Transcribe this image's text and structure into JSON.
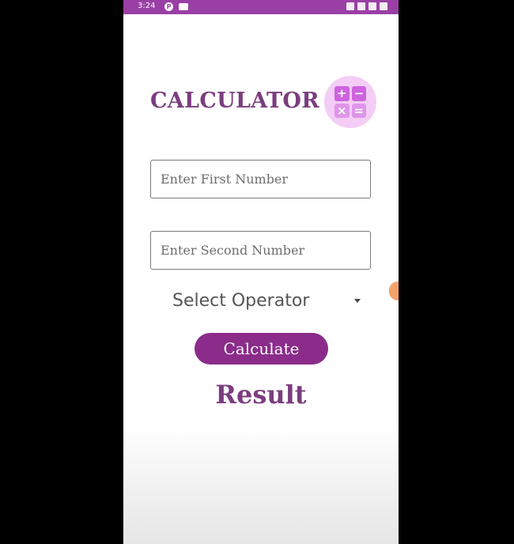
{
  "status_bar": {
    "time": "3:24",
    "app_badge_letter": "P",
    "background_color": "#9a3fa6"
  },
  "app": {
    "title": "CALCULATOR",
    "logo_icon": "calculator-icon",
    "logo_symbols": [
      "+",
      "−",
      "×",
      "="
    ],
    "accent_color": "#8b2c8a",
    "title_color": "#7b3d7f"
  },
  "form": {
    "first_number": {
      "value": "",
      "placeholder": "Enter First Number"
    },
    "second_number": {
      "value": "",
      "placeholder": "Enter Second Number"
    },
    "operator_select": {
      "selected_label": "Select Operator"
    },
    "calculate_label": "Calculate"
  },
  "result": {
    "label": "Result"
  }
}
